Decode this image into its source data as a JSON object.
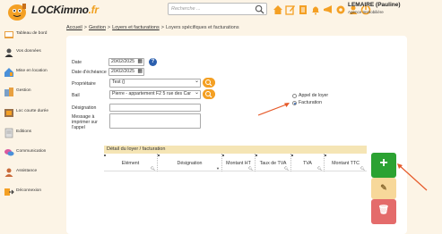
{
  "header": {
    "logo_text": "LOCKimmo",
    "logo_suffix": ".fr",
    "logo_badge": "",
    "search_placeholder": "Recherche ...",
    "user_name": "LEMAIRE (Pauline)",
    "user_agency": "Agence Immobilière",
    "toolbar_icons": [
      "home-icon",
      "edit-icon",
      "document-icon",
      "bell-icon",
      "megaphone-icon",
      "gear-icon",
      "user-icon",
      "logout-icon"
    ]
  },
  "sidebar": {
    "items": [
      {
        "label": "Tableau de bord",
        "icon": "dashboard-icon"
      },
      {
        "label": "Vos données",
        "icon": "user-data-icon"
      },
      {
        "label": "Mise en location",
        "icon": "rental-icon"
      },
      {
        "label": "Gestion",
        "icon": "management-icon"
      },
      {
        "label": "Loc courte durée",
        "icon": "short-rental-icon"
      },
      {
        "label": "Editions",
        "icon": "editions-icon"
      },
      {
        "label": "Communication",
        "icon": "communication-icon"
      },
      {
        "label": "Assistance",
        "icon": "assistance-icon"
      },
      {
        "label": "Déconnexion",
        "icon": "logout-icon"
      }
    ]
  },
  "breadcrumb": {
    "items": [
      "Accueil",
      "Gestion",
      "Loyers et facturations"
    ],
    "current": "Loyers spécifiques et facturations",
    "separator": ">"
  },
  "form": {
    "date_label": "Date",
    "date_value": "20/02/2025",
    "due_date_label": "Date d'échéance",
    "due_date_value": "20/02/2025",
    "owner_label": "Propriétaire",
    "owner_value": "Test ()",
    "lease_label": "Bail",
    "lease_value": "Pierre - appartement F2 5 rue des Car",
    "designation_label": "Désignation",
    "designation_value": "",
    "message_label": "Message à imprimer sur l'appel",
    "message_value": ""
  },
  "radio": {
    "options": [
      "Appel de loyer",
      "Facturation"
    ],
    "selected": "Facturation"
  },
  "table": {
    "title": "Détail du loyer / facturation",
    "columns": [
      "Elément",
      "Désignation",
      "Montant HT",
      "Taux de TVA",
      "TVA",
      "Montant TTC"
    ]
  },
  "actions": {
    "add": "+",
    "edit": "✎",
    "delete": "🗑"
  },
  "colors": {
    "background": "#fcf4e6",
    "accent": "#f4a024",
    "add": "#2ba232",
    "edit": "#f7d89a",
    "delete": "#e46b6b",
    "table_header": "#f5e5b5",
    "annotation_arrow": "#e65a2a"
  }
}
